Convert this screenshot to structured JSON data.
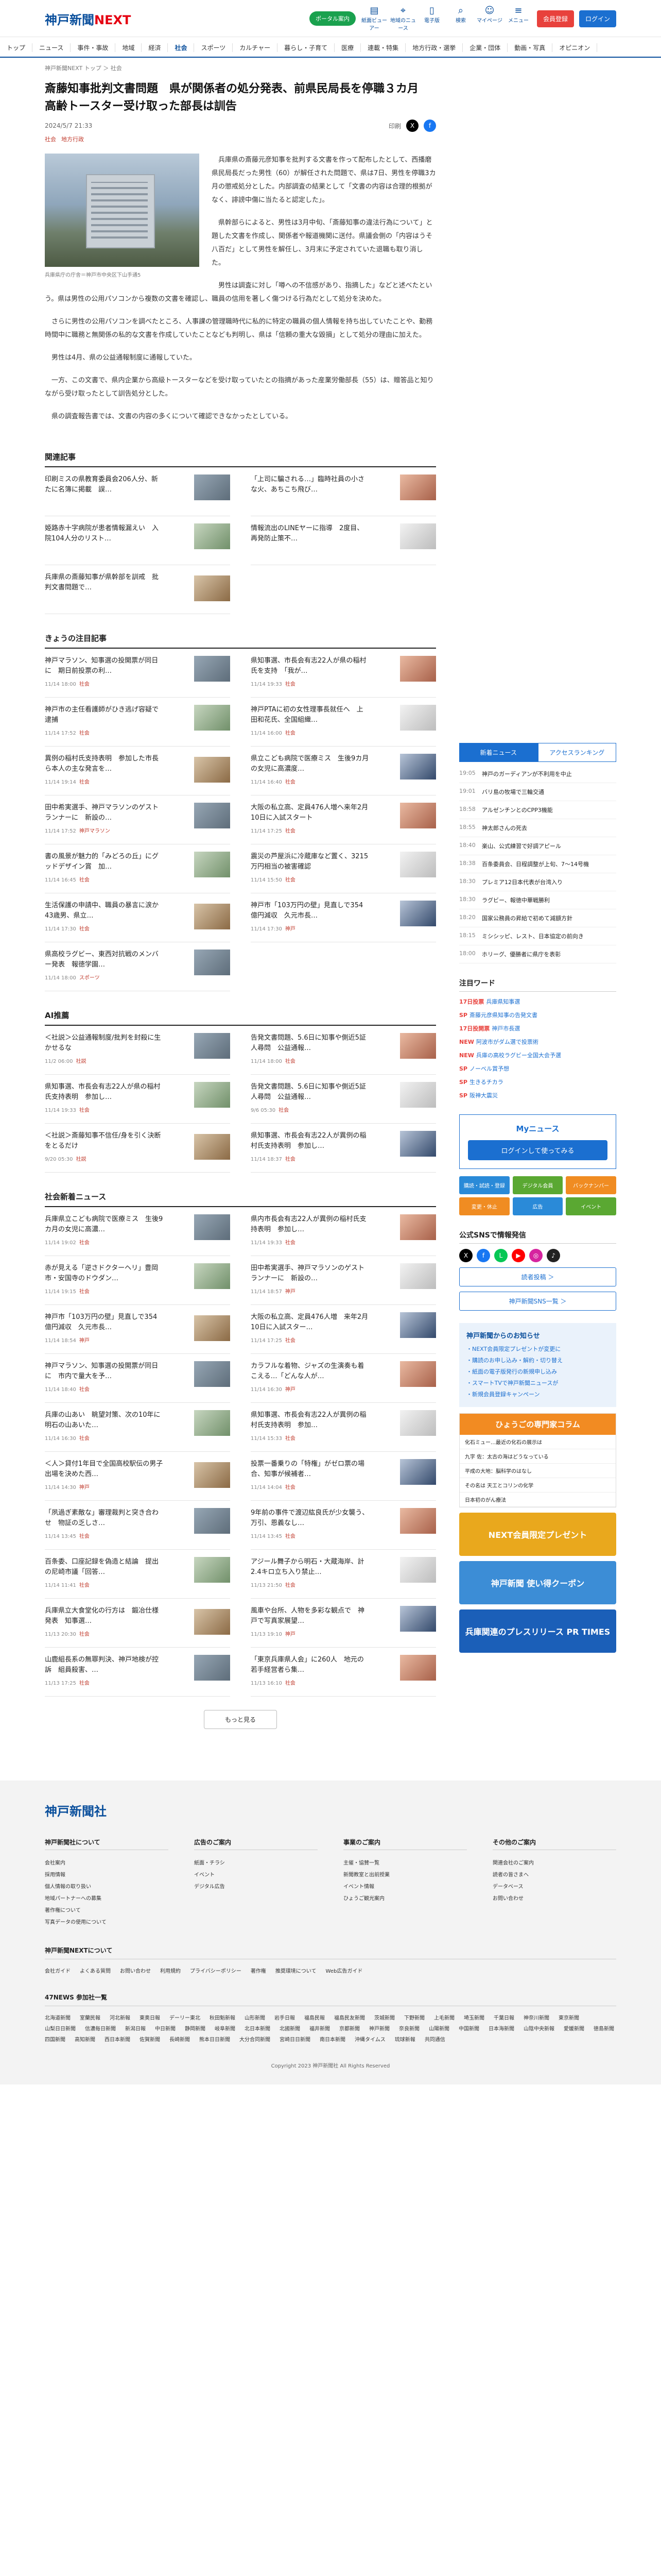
{
  "header": {
    "logo_main": "神戸新聞",
    "logo_accent": "NEXT",
    "premium_label": "ポータル案内",
    "icons": [
      {
        "label": "紙面ビューアー",
        "icon": "newspaper-icon",
        "glyph": "▤"
      },
      {
        "label": "地域のニュース",
        "icon": "map-icon",
        "glyph": "⌖"
      },
      {
        "label": "電子版",
        "icon": "phone-icon",
        "glyph": "▯"
      },
      {
        "label": "検索",
        "icon": "search-icon",
        "glyph": "⌕"
      },
      {
        "label": "マイページ",
        "icon": "user-icon",
        "glyph": "☺"
      },
      {
        "label": "メニュー",
        "icon": "menu-icon",
        "glyph": "≡"
      }
    ],
    "register_label": "会員登録",
    "login_label": "ログイン"
  },
  "nav": [
    "トップ",
    "ニュース",
    "事件・事故",
    "地域",
    "経済",
    "社会",
    "スポーツ",
    "カルチャー",
    "暮らし・子育て",
    "医療",
    "連載・特集",
    "地方行政・選挙",
    "企業・団体",
    "動画・写真",
    "オピニオン"
  ],
  "nav_active": 5,
  "breadcrumbs": "神戸新聞NEXT トップ ＞ 社会",
  "article": {
    "title": "斎藤知事批判文書問題　県が関係者の処分発表、前県民局長を停職３カ月　高齢トースター受け取った部長は訓告",
    "date": "2024/5/7 21:33",
    "tags": [
      "社会",
      "地方行政"
    ],
    "share_print": "印刷",
    "photo_caption": "兵庫県庁の庁舎＝神戸市中央区下山手通5",
    "paragraphs": [
      "兵庫県の斎藤元彦知事を批判する文書を作って配布したとして、西播磨県民局長だった男性（60）が解任された問題で、県は7日、男性を停職3カ月の懲戒処分とした。内部調査の結果として「文書の内容は合理的根拠がなく、誹謗中傷に当たると認定した」。",
      "県幹部らによると、男性は3月中旬、「斎藤知事の違法行為について」と題した文書を作成し、関係者や報道機関に送付。県議会側の「内容はうそ八百だ」として男性を解任し、3月末に予定されていた退職も取り消した。",
      "男性は調査に対し「噂への不信感があり、指摘した」などと述べたという。県は男性の公用パソコンから複数の文書を確認し、職員の信用を著しく傷つける行為だとして処分を決めた。",
      "さらに男性の公用パソコンを調べたところ、人事課の管理職時代に私的に特定の職員の個人情報を持ち出していたことや、勤務時間中に職務と無関係の私的な文書を作成していたことなども判明し、県は「信頼の重大な毀損」として処分の理由に加えた。",
      "男性は4月、県の公益通報制度に通報していた。",
      "一方、この文書で、県内企業から高級トースターなどを受け取っていたとの指摘があった産業労働部長（55）は、贈答品と知りながら受け取ったとして訓告処分とした。",
      "県の調査報告書では、文書の内容の多くについて確認できなかったとしている。"
    ]
  },
  "related": {
    "title": "関連記事",
    "items": [
      {
        "text": "印刷ミスの県教育委員会206人分、新たに名簿に掲載　誤…",
        "date": "",
        "cat": ""
      },
      {
        "text": "「上司に騙される…」臨時社員の小さな火、あちこち飛び…",
        "date": "",
        "cat": ""
      },
      {
        "text": "姫路赤十字病院が患者情報漏えい　入院104人分のリスト…",
        "date": "",
        "cat": ""
      },
      {
        "text": "情報流出のLINEヤーに指導　2度目、再発防止策不…",
        "date": "",
        "cat": ""
      },
      {
        "text": "兵庫県の斎藤知事が県幹部を訓戒　批判文書問題で…",
        "date": "",
        "cat": ""
      }
    ]
  },
  "today_social": {
    "title": "きょうの注目記事",
    "items": [
      {
        "text": "神戸マラソン、知事選の投開票が同日に　期日前投票の利…",
        "date": "11/14 18:00",
        "cat": "社会"
      },
      {
        "text": "県知事選、市長会有志22人が県の稲村氏を支持　「我が…",
        "date": "11/14 19:33",
        "cat": "社会"
      },
      {
        "text": "神戸市の主任看護師がひき逃げ容疑で逮捕",
        "date": "11/14 17:52",
        "cat": "社会"
      },
      {
        "text": "神戸PTAに初の女性理事長就任へ　上田和花氏、全国組織…",
        "date": "11/14 16:00",
        "cat": "社会"
      },
      {
        "text": "異例の稲村氏支持表明　参加した市長ら本人の主な発言を…",
        "date": "11/14 19:14",
        "cat": "社会"
      },
      {
        "text": "県立こども病院で医療ミス　生後9カ月の女児に高濃度…",
        "date": "11/14 16:40",
        "cat": "社会"
      },
      {
        "text": "田中希実選手、神戸マラソンのゲストランナーに　新設の…",
        "date": "11/14 17:52",
        "cat": "神戸マラソン"
      },
      {
        "text": "大阪の私立高、定員476人増へ来年2月10日に入試スタート",
        "date": "11/14 17:25",
        "cat": "社会"
      },
      {
        "text": "書の風景が魅力的「みどろの丘」にグッドデザイン賞　加…",
        "date": "11/14 16:45",
        "cat": "社会"
      },
      {
        "text": "震災の芦屋浜に冷蔵庫など置く、3215万円相当の被害確認",
        "date": "11/14 15:50",
        "cat": "社会"
      },
      {
        "text": "生活保護の申請中、職員の暴言に涙か　43歳男、県立…",
        "date": "11/14 17:30",
        "cat": "社会"
      },
      {
        "text": "神戸市「103万円の壁」見直しで354億円減収　久元市長…",
        "date": "11/14 17:30",
        "cat": "神戸"
      },
      {
        "text": "県高校ラグビー、東西対抗戦のメンバー発表　報徳学園…",
        "date": "11/14 18:00",
        "cat": "スポーツ"
      }
    ]
  },
  "ai": {
    "title": "AI推薦",
    "items": [
      {
        "text": "＜社説＞公益通報制度/批判を封殺に生かせるな",
        "date": "11/2 06:00",
        "cat": "社説"
      },
      {
        "text": "告発文書問題、5.6日に知事や側近5証人尋問　公益通報…",
        "date": "11/14 18:00",
        "cat": "社会"
      },
      {
        "text": "県知事選、市長会有志22人が県の稲村氏支持表明　参加し…",
        "date": "11/14 19:33",
        "cat": "社会"
      },
      {
        "text": "告発文書問題、5.6日に知事や側近5証人尋問　公益通報…",
        "date": "9/6 05:30",
        "cat": "社会"
      },
      {
        "text": "＜社説＞斎藤知事不信任/身を引く決断をとるだけ",
        "date": "9/20 05:30",
        "cat": "社説"
      },
      {
        "text": "県知事選、市長会有志22人が異例の稲村氏支持表明　参加し…",
        "date": "11/14 18:37",
        "cat": "社会"
      }
    ]
  },
  "social_news": {
    "title": "社会新着ニュース",
    "items": [
      {
        "text": "兵庫県立こども病院で医療ミス　生後9カ月の女児に高濃…",
        "date": "11/14 19:02",
        "cat": "社会"
      },
      {
        "text": "県内市長会有志22人が異例の稲村氏支持表明　参加し…",
        "date": "11/14 19:33",
        "cat": "社会"
      },
      {
        "text": "赤が見える「逆さドクターヘリ」豊岡市・安国寺のドウダン…",
        "date": "11/14 19:15",
        "cat": "社会"
      },
      {
        "text": "田中希実選手、神戸マラソンのゲストランナーに　新設の…",
        "date": "11/14 18:57",
        "cat": "神戸"
      },
      {
        "text": "神戸市「103万円の壁」見直しで354億円減収　久元市長…",
        "date": "11/14 18:54",
        "cat": "神戸"
      },
      {
        "text": "大阪の私立高、定員476人増　来年2月10日に入試スター…",
        "date": "11/14 17:25",
        "cat": "社会"
      },
      {
        "text": "神戸マラソン、知事選の投開票が同日に　市内で量大を予…",
        "date": "11/14 18:40",
        "cat": "社会"
      },
      {
        "text": "カラフルな着物、ジャズの生演奏も着こえる…「どんな人が…",
        "date": "11/14 16:30",
        "cat": "神戸"
      },
      {
        "text": "兵庫の山あい　眺望対策、次の10年に　明石の山あいた…",
        "date": "11/14 16:30",
        "cat": "社会"
      },
      {
        "text": "県知事選、市長会有志22人が異例の稲村氏支持表明　参加…",
        "date": "11/14 15:33",
        "cat": "社会"
      },
      {
        "text": "＜人＞貸付1年目で全国高校駅伝の男子出場を決めた西…",
        "date": "11/14 14:30",
        "cat": "神戸"
      },
      {
        "text": "投票一番乗りの「特権」がゼロ票の場合、知事が候補者…",
        "date": "11/14 14:04",
        "cat": "社会"
      },
      {
        "text": "「夙過ぎ素敵な」審理裁判と突き合わせ　物証の乏しさ…",
        "date": "11/14 13:45",
        "cat": "社会"
      },
      {
        "text": "9年前の事件で渡辺紘良氏が少女襲う、万引、恩義なし…",
        "date": "11/14 13:45",
        "cat": "社会"
      },
      {
        "text": "百条委、口座記録を偽造と結論　提出の尼崎市議「回答…",
        "date": "11/14 11:41",
        "cat": "社会"
      },
      {
        "text": "アジール舞子から明石・大蔵海岸、計2.4キロ立ち入り禁止…",
        "date": "11/13 21:50",
        "cat": "社会"
      },
      {
        "text": "兵庫県立大食堂化の行方は　鍛冶仕様発表　知事選…",
        "date": "11/13 20:30",
        "cat": "社会"
      },
      {
        "text": "風車や台所、人物を多彩な観点で　神戸で写真家展望…",
        "date": "11/13 19:10",
        "cat": "神戸"
      },
      {
        "text": "山鹿組長系の無罪判決、神戸地検が控訴　組員殺害、…",
        "date": "11/13 17:25",
        "cat": "社会"
      },
      {
        "text": "「東京兵庫県人会」に260人　地元の若手経営者ら集…",
        "date": "11/13 16:10",
        "cat": "社会"
      }
    ],
    "more": "もっと見る"
  },
  "sidebar": {
    "tab_on": "新着ニュース",
    "tab_off": "アクセスランキング",
    "ranking": [
      {
        "time": "19:05",
        "text": "神戸のガーディアンが不利用を中止"
      },
      {
        "time": "19:01",
        "text": "バリ島の牧場で三輪交通"
      },
      {
        "time": "18:58",
        "text": "アルゼンチンとのCPP3機能"
      },
      {
        "time": "18:55",
        "text": "神太郎さんの死去"
      },
      {
        "time": "18:40",
        "text": "楽山、公式練習で好調アピール"
      },
      {
        "time": "18:38",
        "text": "百条委員会、日程調整が上旬、7〜14号機"
      },
      {
        "time": "18:30",
        "text": "プレミア12日本代表が台湾入り"
      },
      {
        "time": "18:30",
        "text": "ラグビー、報徳中華戦勝利"
      },
      {
        "time": "18:20",
        "text": "国家公務員の昇給で初めて減額方針"
      },
      {
        "time": "18:15",
        "text": "ミシシッピ、レスト、日本協定の前向き"
      },
      {
        "time": "18:00",
        "text": "ホリーグ、優勝者に県庁を表彰"
      }
    ],
    "topics_title": "注目ワード",
    "topics": [
      {
        "n": "17日投票",
        "text": "兵庫県知事選"
      },
      {
        "n": "SP",
        "text": "斎藤元彦県知事の告発文書"
      },
      {
        "n": "17日投開票",
        "text": "神戸市長選"
      },
      {
        "n": "NEW",
        "text": "阿波市がダム選で投票術"
      },
      {
        "n": "NEW",
        "text": "兵庫の高校ラグビー全国大会予選"
      },
      {
        "n": "SP",
        "text": "ノーベル賞予想"
      },
      {
        "n": "SP",
        "text": "生きるチカラ"
      },
      {
        "n": "SP",
        "text": "阪神大震災"
      }
    ],
    "my_title": "Myニュース",
    "my_button": "ログインして使ってみる",
    "color_buttons": [
      {
        "label": "購読・試読・登録",
        "color": "#2a8ad8"
      },
      {
        "label": "デジタル会員",
        "color": "#5aa832"
      },
      {
        "label": "バックナンバー",
        "color": "#f08c22"
      },
      {
        "label": "変更・休止",
        "color": "#f08c22"
      },
      {
        "label": "広告",
        "color": "#2a8ad8"
      },
      {
        "label": "イベント",
        "color": "#5aa832"
      }
    ],
    "sns_title": "公式SNSで情報発信",
    "sns": [
      {
        "icon": "x-icon",
        "glyph": "X",
        "color": "#000000"
      },
      {
        "icon": "facebook-icon",
        "glyph": "f",
        "color": "#1877f2"
      },
      {
        "icon": "line-icon",
        "glyph": "L",
        "color": "#06c755"
      },
      {
        "icon": "youtube-icon",
        "glyph": "▶",
        "color": "#ff0000"
      },
      {
        "icon": "instagram-icon",
        "glyph": "◎",
        "color": "#d6249f"
      },
      {
        "icon": "tiktok-icon",
        "glyph": "♪",
        "color": "#222222"
      }
    ],
    "link1": "読者投稿 ＞",
    "link2": "神戸新聞SNS一覧 ＞",
    "notice_title": "神戸新聞からのお知らせ",
    "notices": [
      "・NEXT会員限定プレゼントが変更に",
      "・購読のお申し込み・解約・切り替え",
      "・紙面の電子版発行の新規申し込み",
      "・スマートTVで神戸新聞ニュースが",
      "・新規会員登録キャンペーン"
    ],
    "column_title": "ひょうごの専門家コラム",
    "columns": [
      "化石ミュー…最近の化石の展示は",
      "九字 佐：太古の海はどうなっている",
      "平成の大地：脳科学のはなし",
      "その名は 天工とコリンの化学",
      "日本初のがん療法"
    ],
    "banners": [
      {
        "text": "NEXT会員限定プレゼント",
        "color": "#e9a81d"
      },
      {
        "text": "神戸新聞 使い得クーポン",
        "color": "#3c8dd6"
      },
      {
        "text": "兵庫関連のプレスリリース PR TIMES",
        "color": "#1b5fb8"
      }
    ]
  },
  "footer": {
    "logo": "神戸新聞社",
    "cols": [
      {
        "title": "神戸新聞社について",
        "items": [
          "会社案内",
          "採用情報",
          "個人情報の取り扱い",
          "地域パートナーへの募集",
          "著作権について",
          "写真データの使用について"
        ]
      },
      {
        "title": "広告のご案内",
        "items": [
          "紙面・チラシ",
          "イベント",
          "デジタル広告"
        ]
      },
      {
        "title": "事業のご案内",
        "items": [
          "主催・協賛一覧",
          "新聞教室と出前授業",
          "イベント情報",
          "ひょうご観光案内"
        ]
      },
      {
        "title": "その他のご案内",
        "items": [
          "関連会社のご案内",
          "読者の皆さまへ",
          "データベース",
          "お問い合わせ"
        ]
      }
    ],
    "next_title": "神戸新聞NEXTについて",
    "next_links": [
      "会社ガイド",
      "よくある質問",
      "お問い合わせ",
      "利用規約",
      "プライバシーポリシー",
      "著作権",
      "推奨環境について",
      "Web広告ガイド"
    ],
    "news_title": "47NEWS 参加社一覧",
    "news_links": [
      "北海道新聞",
      "室蘭民報",
      "河北新報",
      "東奥日報",
      "デーリー東北",
      "秋田魁新報",
      "山形新聞",
      "岩手日報",
      "福島民報",
      "福島民友新聞",
      "茨城新聞",
      "下野新聞",
      "上毛新聞",
      "埼玉新聞",
      "千葉日報",
      "神奈川新聞",
      "東京新聞",
      "山梨日日新聞",
      "信濃毎日新聞",
      "新潟日報",
      "中日新聞",
      "静岡新聞",
      "岐阜新聞",
      "北日本新聞",
      "北國新聞",
      "福井新聞",
      "京都新聞",
      "神戸新聞",
      "奈良新聞",
      "山陽新聞",
      "中国新聞",
      "日本海新聞",
      "山陰中央新報",
      "愛媛新聞",
      "徳島新聞",
      "四国新聞",
      "高知新聞",
      "西日本新聞",
      "佐賀新聞",
      "長崎新聞",
      "熊本日日新聞",
      "大分合同新聞",
      "宮崎日日新聞",
      "南日本新聞",
      "沖縄タイムス",
      "琉球新報",
      "共同通信"
    ],
    "copyright": "Copyright 2023 神戸新聞社 All Rights Reserved"
  }
}
